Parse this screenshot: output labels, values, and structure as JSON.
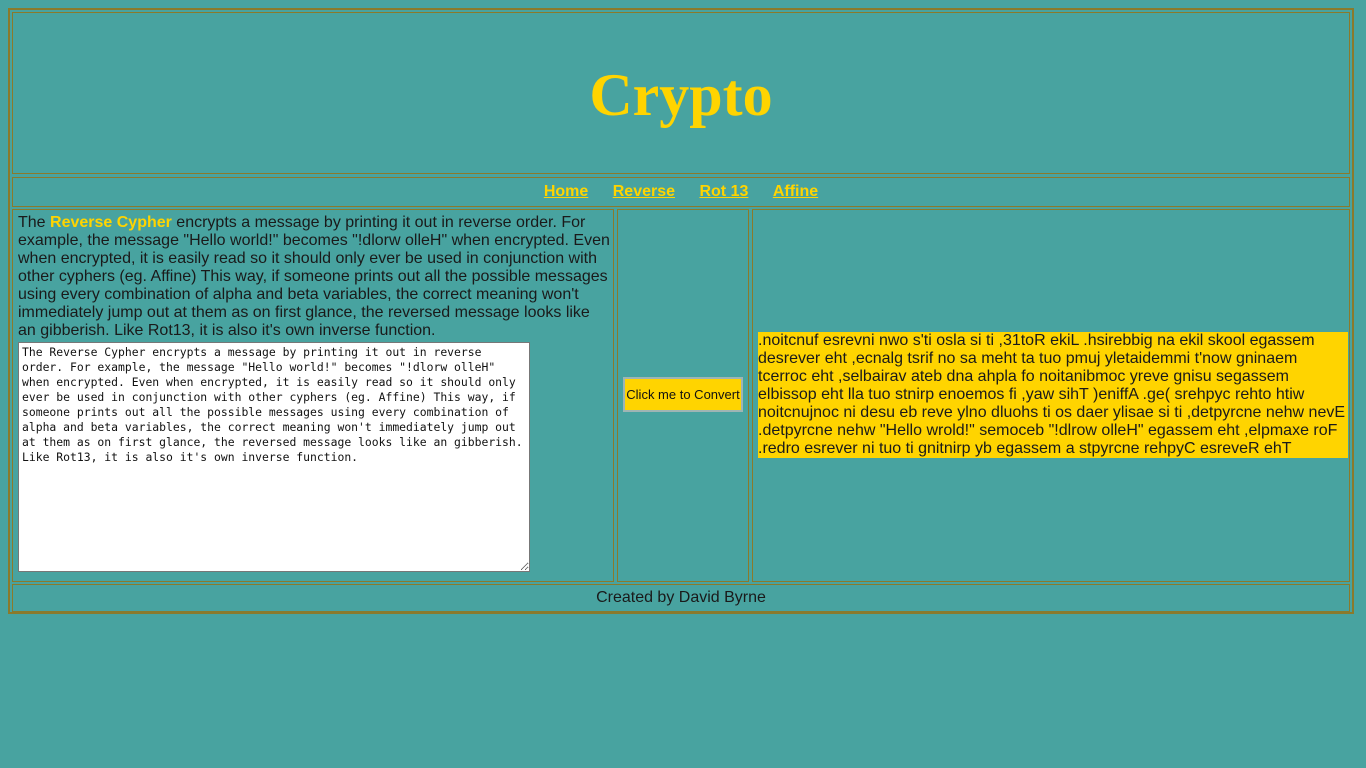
{
  "header": {
    "title": "Crypto"
  },
  "nav": {
    "items": [
      {
        "label": "Home"
      },
      {
        "label": "Reverse"
      },
      {
        "label": "Rot 13"
      },
      {
        "label": "Affine"
      }
    ]
  },
  "description": {
    "prefix": "The ",
    "highlight": "Reverse Cypher",
    "body": " encrypts a message by printing it out in reverse order. For example, the message \"Hello world!\" becomes \"!dlorw olleH\" when encrypted. Even when encrypted, it is easily read so it should only ever be used in conjunction with other cyphers (eg. Affine) This way, if someone prints out all the possible messages using every combination of alpha and beta variables, the correct meaning won't immediately jump out at them as on first glance, the reversed message looks like an gibberish. Like Rot13, it is also it's own inverse function."
  },
  "input": {
    "value": "The Reverse Cypher encrypts a message by printing it out in reverse order. For example, the message \"Hello world!\" becomes \"!dlorw olleH\" when encrypted. Even when encrypted, it is easily read so it should only ever be used in conjunction with other cyphers (eg. Affine) This way, if someone prints out all the possible messages using every combination of alpha and beta variables, the correct meaning won't immediately jump out at them as on first glance, the reversed message looks like an gibberish. Like Rot13, it is also it's own inverse function."
  },
  "convert_button": {
    "label": "Click me to Convert"
  },
  "output": {
    "lines": [
      ".noitcnuf esrevni nwo s'ti osla si ti ,31toR ekiL .hsirebbig na ekil skool egassem",
      "desrever eht ,ecnalg tsrif no sa meht ta tuo pmuj yletaidemmi t'now gninaem",
      "tcerroc eht ,selbairav ateb dna ahpla fo noitanibmoc yreve gnisu segassem",
      "elbissop eht lla tuo stnirp enoemos fi ,yaw sihT )eniffA .ge( srehpyc rehto htiw",
      "noitcnujnoc ni desu eb reve ylno dluohs ti os daer ylisae si ti ,detpyrcne nehw nevE",
      ".detpyrcne nehw \"Hello wrold!\" semoceb \"!dlrow olleH\" egassem eht ,elpmaxe roF",
      ".redro esrever ni tuo ti gnitnirp yb egassem a stpyrcne rehpyC esreveR ehT"
    ]
  },
  "footer": {
    "text": "Created by David Byrne"
  },
  "colors": {
    "background": "#48a3a0",
    "accent": "#ffd400",
    "border": "#8a7a2c"
  }
}
